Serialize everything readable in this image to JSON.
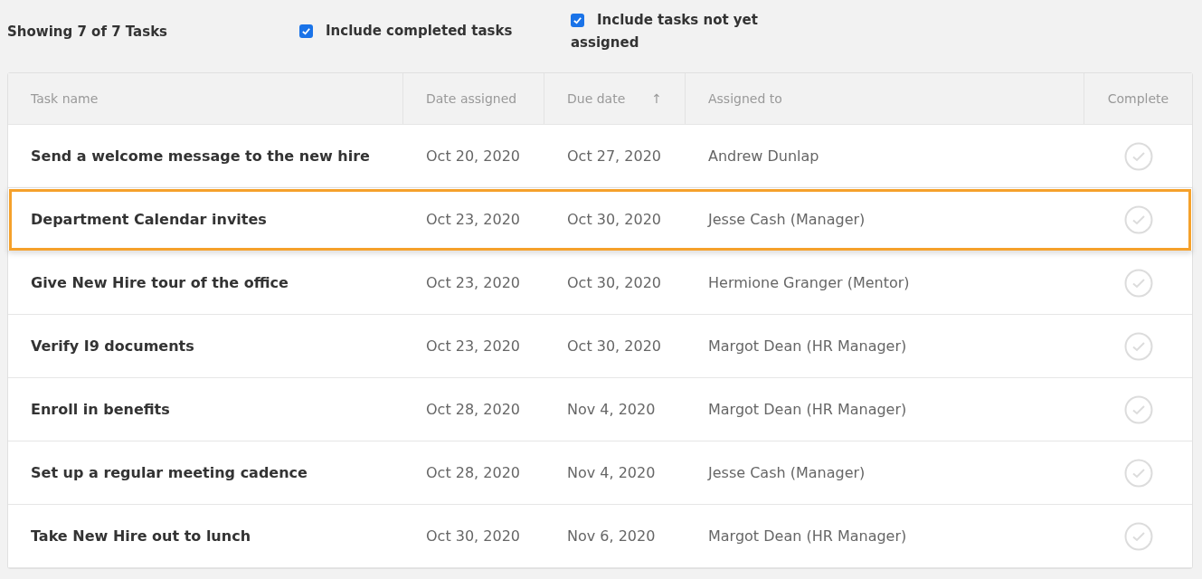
{
  "summary": "Showing 7 of 7 Tasks",
  "filters": [
    {
      "label": "Include completed tasks",
      "checked": true
    },
    {
      "label": "Include tasks not yet assigned",
      "checked": true
    }
  ],
  "table": {
    "columns": [
      {
        "label": "Task name"
      },
      {
        "label": "Date assigned"
      },
      {
        "label": "Due date",
        "sort_indicator": "↑"
      },
      {
        "label": "Assigned to"
      },
      {
        "label": "Complete"
      }
    ],
    "rows": [
      {
        "task": "Send a welcome message to the new hire",
        "date_assigned": "Oct 20, 2020",
        "due_date": "Oct 27, 2020",
        "assigned_to": "Andrew Dunlap",
        "complete": false,
        "highlighted": false
      },
      {
        "task": "Department Calendar invites",
        "date_assigned": "Oct 23, 2020",
        "due_date": "Oct 30, 2020",
        "assigned_to": "Jesse Cash (Manager)",
        "complete": false,
        "highlighted": true
      },
      {
        "task": "Give New Hire tour of the office",
        "date_assigned": "Oct 23, 2020",
        "due_date": "Oct 30, 2020",
        "assigned_to": "Hermione Granger (Mentor)",
        "complete": false,
        "highlighted": false
      },
      {
        "task": "Verify I9 documents",
        "date_assigned": "Oct 23, 2020",
        "due_date": "Oct 30, 2020",
        "assigned_to": "Margot Dean (HR Manager)",
        "complete": false,
        "highlighted": false
      },
      {
        "task": "Enroll in benefits",
        "date_assigned": "Oct 28, 2020",
        "due_date": "Nov 4, 2020",
        "assigned_to": "Margot Dean (HR Manager)",
        "complete": false,
        "highlighted": false
      },
      {
        "task": "Set up a regular meeting cadence",
        "date_assigned": "Oct 28, 2020",
        "due_date": "Nov 4, 2020",
        "assigned_to": "Jesse Cash (Manager)",
        "complete": false,
        "highlighted": false
      },
      {
        "task": "Take New Hire out to lunch",
        "date_assigned": "Oct 30, 2020",
        "due_date": "Nov 6, 2020",
        "assigned_to": "Margot Dean (HR Manager)",
        "complete": false,
        "highlighted": false
      }
    ]
  }
}
